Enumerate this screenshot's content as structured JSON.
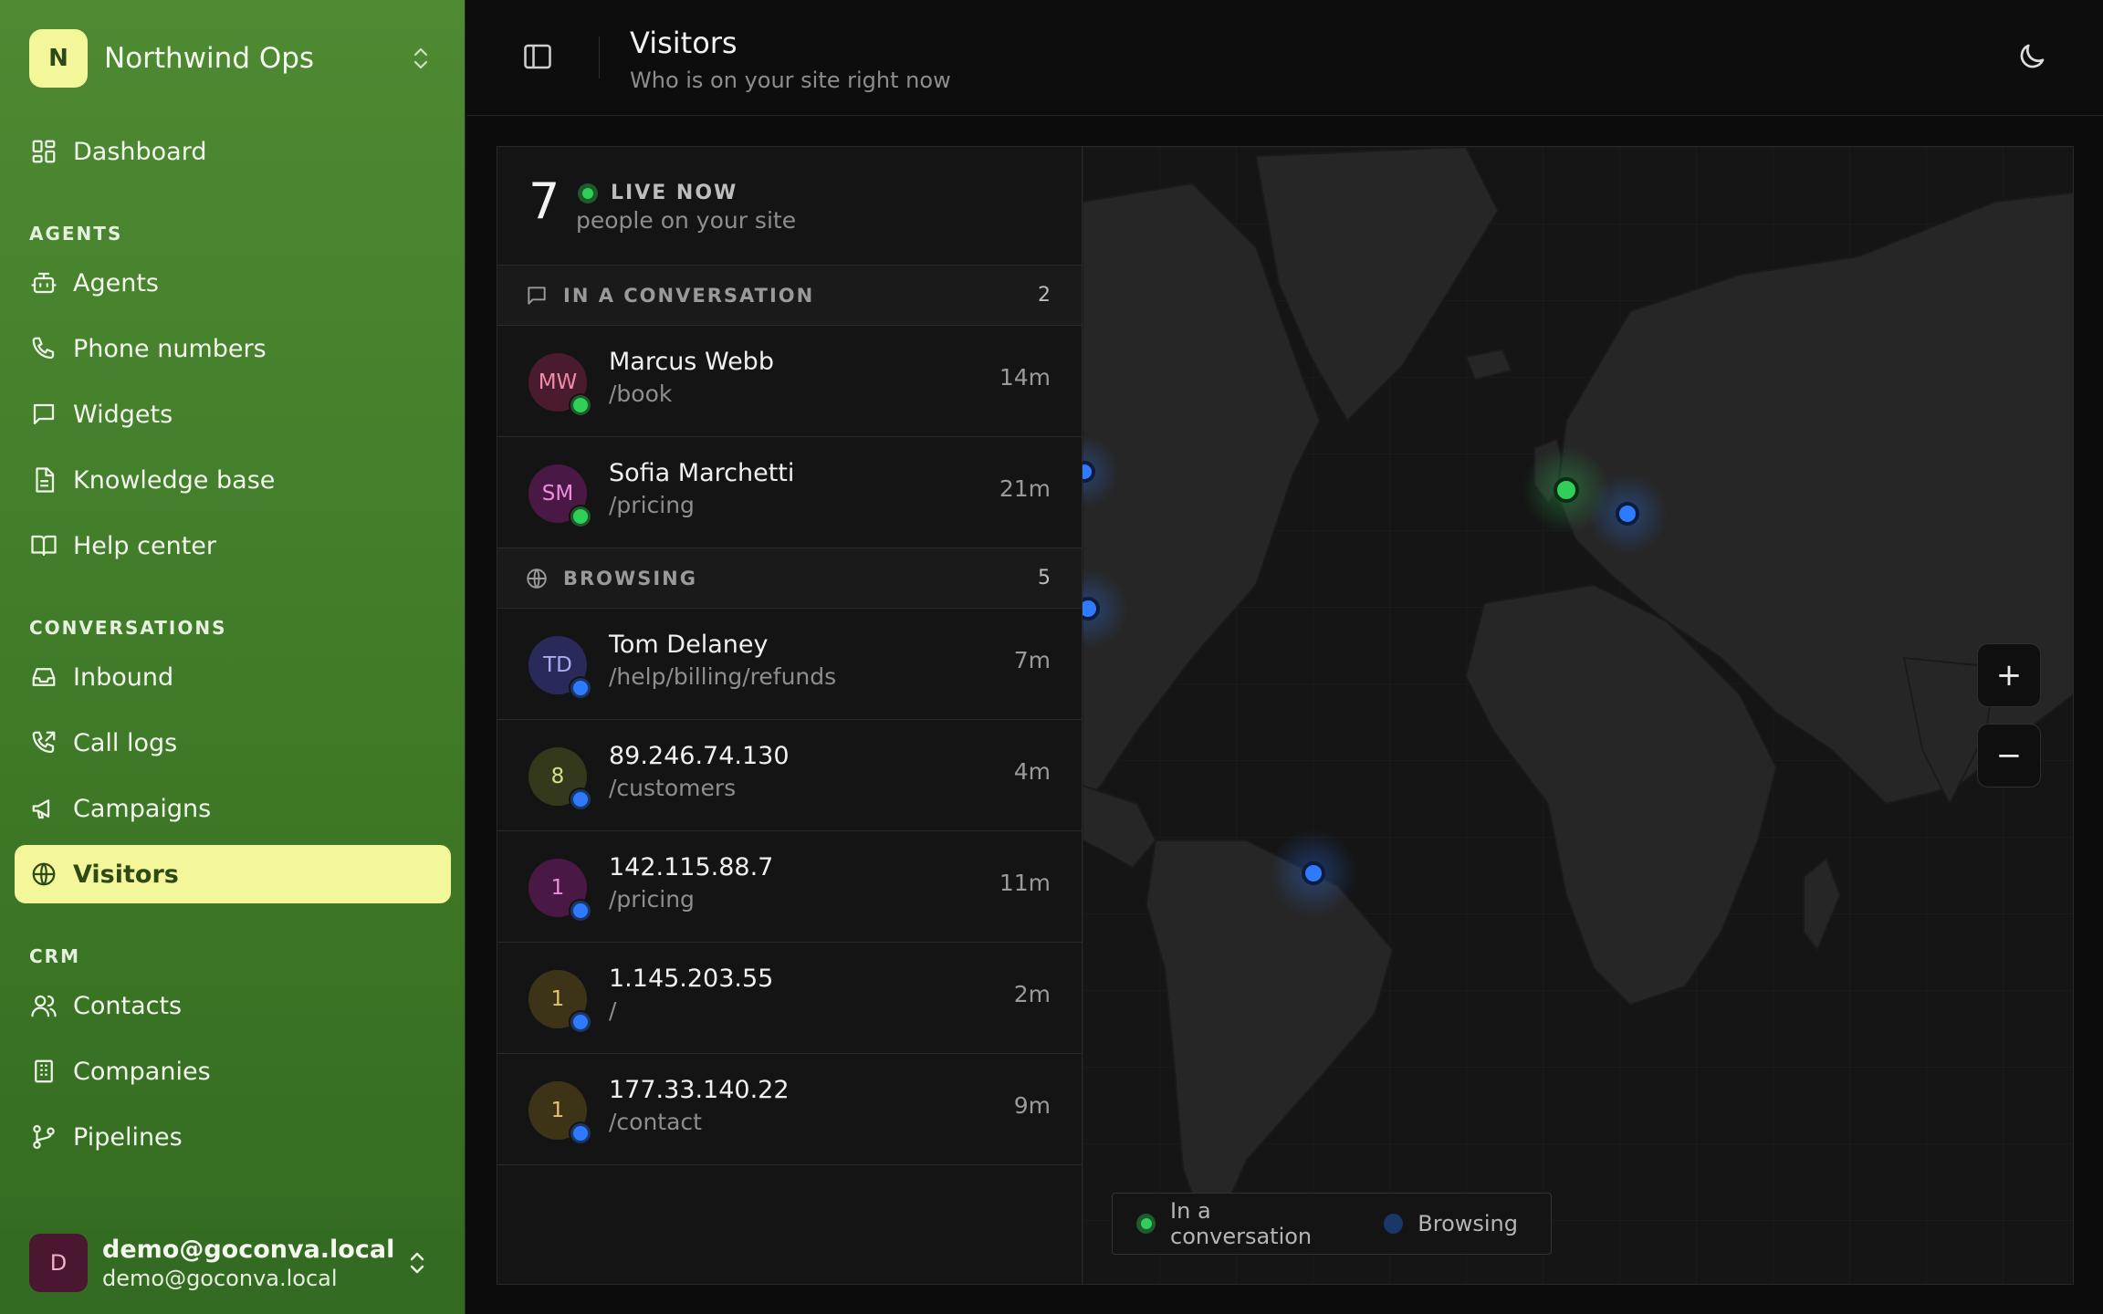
{
  "workspace": {
    "initial": "N",
    "name": "Northwind Ops"
  },
  "nav": {
    "dashboard": "Dashboard",
    "sections": {
      "agents": "AGENTS",
      "conversations": "CONVERSATIONS",
      "crm": "CRM"
    },
    "agents": [
      "Agents",
      "Phone numbers",
      "Widgets",
      "Knowledge base",
      "Help center"
    ],
    "conversations": [
      "Inbound",
      "Call logs",
      "Campaigns",
      "Visitors"
    ],
    "crm": [
      "Contacts",
      "Companies",
      "Pipelines"
    ]
  },
  "user": {
    "initial": "D",
    "name": "demo@goconva.local",
    "email": "demo@goconva.local"
  },
  "header": {
    "title": "Visitors",
    "subtitle": "Who is on your site right now"
  },
  "live": {
    "count": "7",
    "label": "LIVE NOW",
    "sub": "people on your site"
  },
  "groups": {
    "conversation": {
      "label": "IN A CONVERSATION",
      "count": "2"
    },
    "browsing": {
      "label": "BROWSING",
      "count": "5"
    }
  },
  "visitors_conversation": [
    {
      "initials": "MW",
      "name": "Marcus Webb",
      "path": "/book",
      "time": "14m"
    },
    {
      "initials": "SM",
      "name": "Sofia Marchetti",
      "path": "/pricing",
      "time": "21m"
    }
  ],
  "visitors_browsing": [
    {
      "initials": "TD",
      "name": "Tom Delaney",
      "path": "/help/billing/refunds",
      "time": "7m"
    },
    {
      "initials": "8",
      "name": "89.246.74.130",
      "path": "/customers",
      "time": "4m"
    },
    {
      "initials": "1",
      "name": "142.115.88.7",
      "path": "/pricing",
      "time": "11m"
    },
    {
      "initials": "1",
      "name": "1.145.203.55",
      "path": "/",
      "time": "2m"
    },
    {
      "initials": "1",
      "name": "177.33.140.22",
      "path": "/contact",
      "time": "9m"
    }
  ],
  "map": {
    "zoom_in": "+",
    "zoom_out": "−",
    "legend": {
      "conversation": "In a conversation",
      "browsing": "Browsing"
    }
  },
  "colors": {
    "accent": "#f4f69a",
    "conversation": "#2fcf5a",
    "browsing": "#2f7bff",
    "sidebar": "#4e8a32"
  }
}
